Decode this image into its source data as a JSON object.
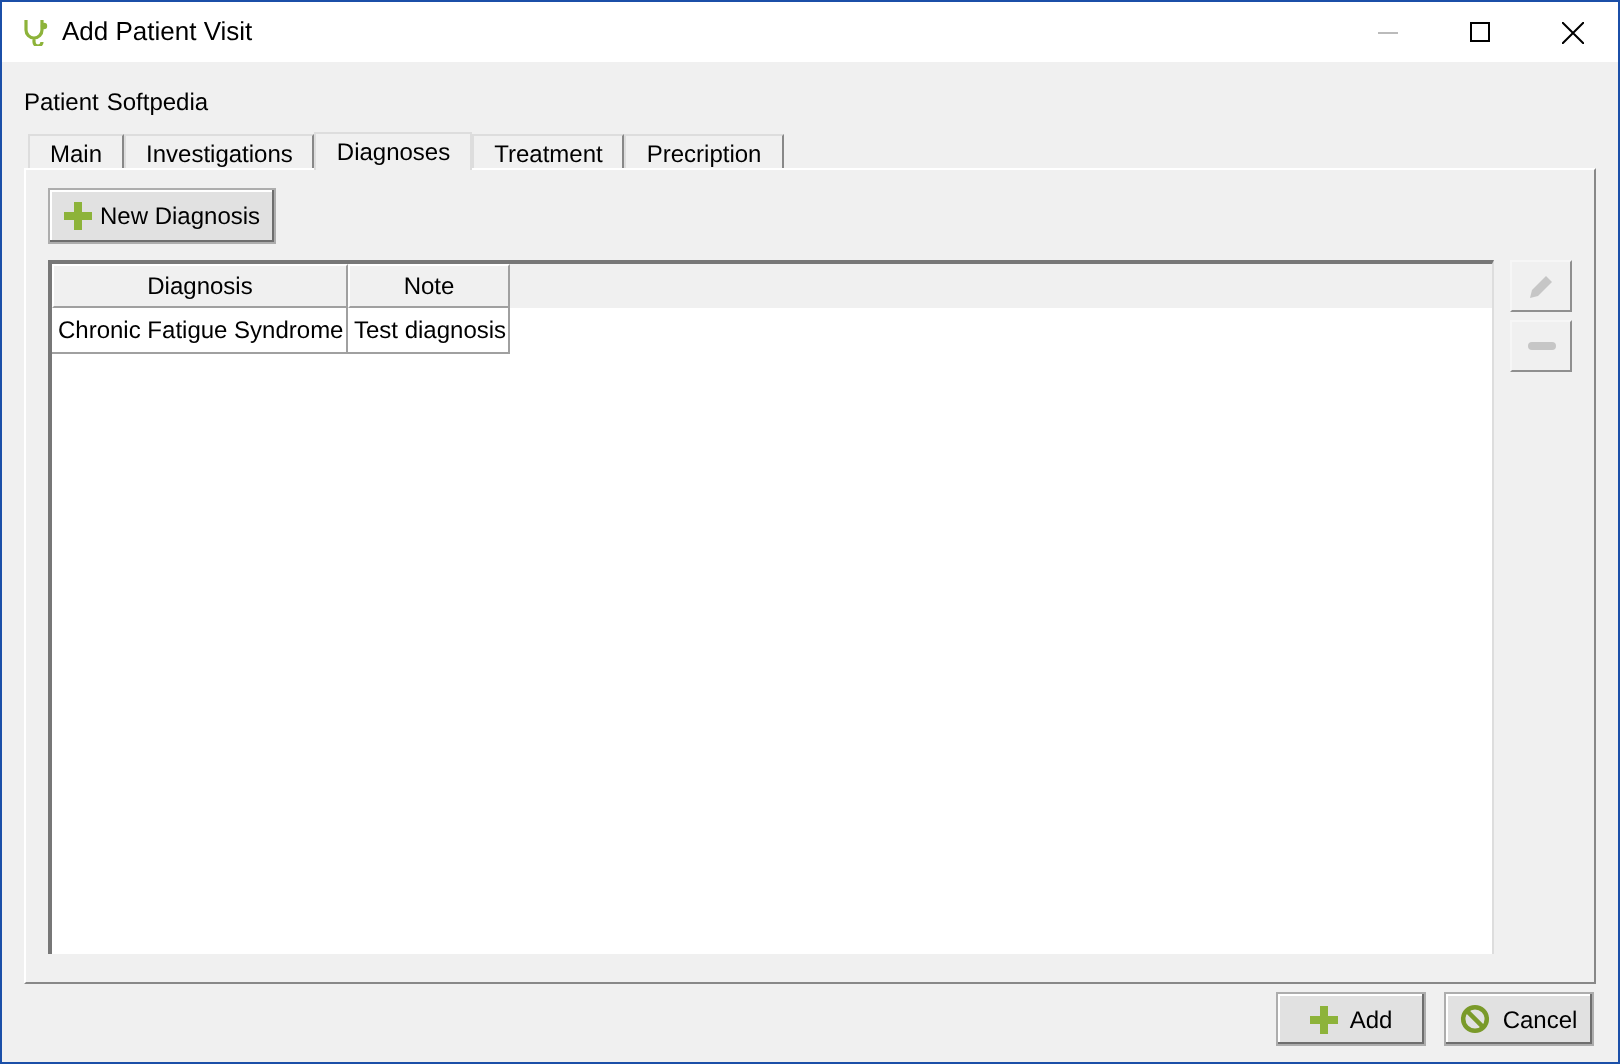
{
  "window": {
    "title": "Add Patient Visit"
  },
  "patient": {
    "label": "Patient",
    "value": "Softpedia"
  },
  "tabs": [
    {
      "label": "Main",
      "selected": false
    },
    {
      "label": "Investigations",
      "selected": false
    },
    {
      "label": "Diagnoses",
      "selected": true
    },
    {
      "label": "Treatment",
      "selected": false
    },
    {
      "label": "Precription",
      "selected": false
    }
  ],
  "new_button": "New Diagnosis",
  "table": {
    "columns": [
      "Diagnosis",
      "Note"
    ],
    "rows": [
      [
        "Chronic Fatigue Syndrome",
        "Test diagnosis"
      ]
    ]
  },
  "side_buttons": [
    {
      "kind": "edit",
      "disabled": true
    },
    {
      "kind": "remove",
      "disabled": true
    }
  ],
  "footer_buttons": [
    {
      "kind": "add",
      "label": "Add"
    },
    {
      "kind": "cancel",
      "label": "Cancel"
    }
  ]
}
